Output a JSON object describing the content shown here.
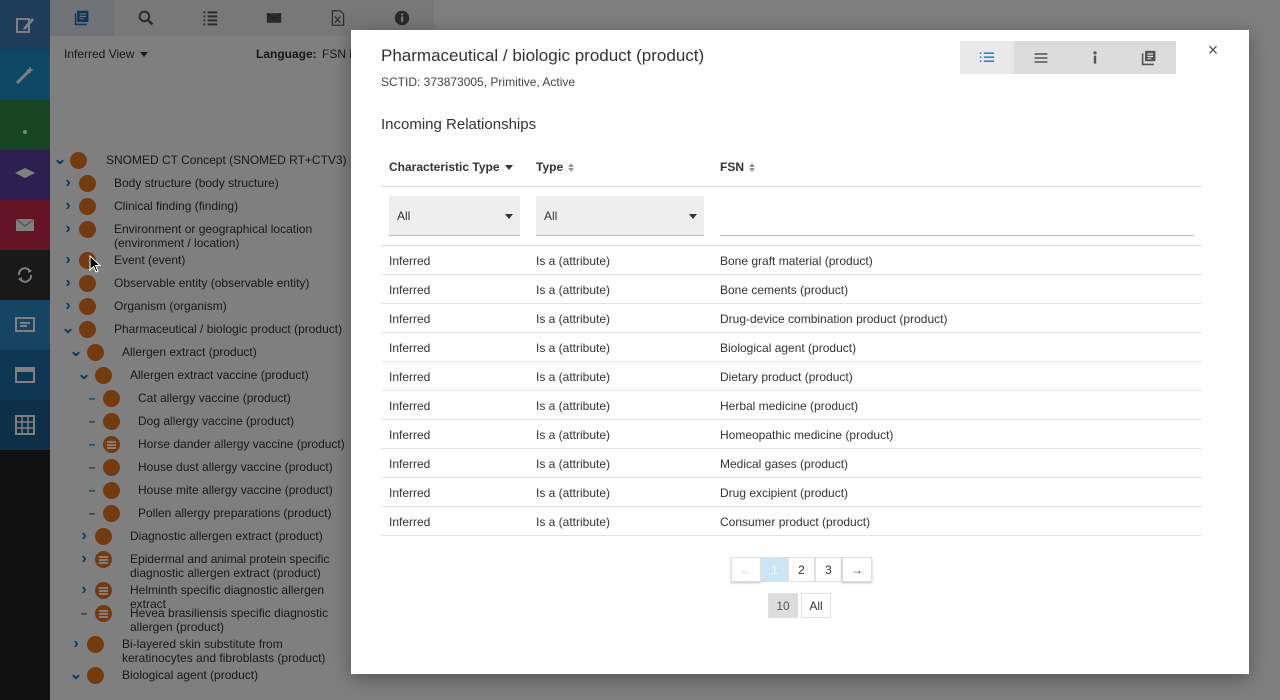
{
  "rail": {
    "items": [
      {
        "icon": "edit-icon",
        "color": "#3a7bb5"
      },
      {
        "icon": "wand-icon",
        "color": "#1b8fc7"
      },
      {
        "icon": "bell-icon",
        "color": "#2e8b45"
      },
      {
        "icon": "graduation-icon",
        "color": "#5b3fa1"
      },
      {
        "icon": "mail-icon",
        "color": "#c9284a"
      },
      {
        "icon": "sync-icon",
        "color": "#333333"
      },
      {
        "icon": "feedback-icon",
        "color": "#2d8ac9"
      },
      {
        "icon": "browser-icon",
        "color": "#1f6fa6"
      },
      {
        "icon": "grid-icon",
        "color": "#1a5f8f"
      }
    ]
  },
  "panel": {
    "tabs": [
      "taxonomy-icon",
      "search-icon",
      "list-icon",
      "mail-icon",
      "excel-icon",
      "info-icon"
    ],
    "view_label": "Inferred View",
    "language_label": "Language:",
    "language_value": "FSN i",
    "tree": [
      {
        "label": "SNOMED CT Concept (SNOMED RT+CTV3)",
        "toggle": "open",
        "depth": 0,
        "dot": "plain"
      },
      {
        "label": "Body structure (body structure)",
        "toggle": "closed",
        "depth": 1,
        "dot": "plain"
      },
      {
        "label": "Clinical finding (finding)",
        "toggle": "closed",
        "depth": 1,
        "dot": "plain"
      },
      {
        "label": "Environment or geographical location (environment / location)",
        "toggle": "closed",
        "depth": 1,
        "dot": "plain"
      },
      {
        "label": "Event (event)",
        "toggle": "closed",
        "depth": 1,
        "dot": "plain"
      },
      {
        "label": "Observable entity (observable entity)",
        "toggle": "closed",
        "depth": 1,
        "dot": "plain"
      },
      {
        "label": "Organism (organism)",
        "toggle": "closed",
        "depth": 1,
        "dot": "plain"
      },
      {
        "label": "Pharmaceutical / biologic product (product)",
        "toggle": "open",
        "depth": 1,
        "dot": "plain"
      },
      {
        "label": "Allergen extract (product)",
        "toggle": "open",
        "depth": 2,
        "dot": "plain"
      },
      {
        "label": "Allergen extract vaccine (product)",
        "toggle": "open",
        "depth": 3,
        "dot": "plain"
      },
      {
        "label": "Cat allergy vaccine (product)",
        "toggle": "leaf",
        "depth": 4,
        "dot": "plain"
      },
      {
        "label": "Dog allergy vaccine (product)",
        "toggle": "leaf",
        "depth": 4,
        "dot": "plain"
      },
      {
        "label": "Horse dander allergy vaccine (product)",
        "toggle": "leaf",
        "depth": 4,
        "dot": "lines"
      },
      {
        "label": "House dust allergy vaccine (product)",
        "toggle": "leaf",
        "depth": 4,
        "dot": "plain"
      },
      {
        "label": "House mite allergy vaccine (product)",
        "toggle": "leaf",
        "depth": 4,
        "dot": "plain"
      },
      {
        "label": "Pollen allergy preparations (product)",
        "toggle": "leaf",
        "depth": 4,
        "dot": "plain"
      },
      {
        "label": "Diagnostic allergen extract (product)",
        "toggle": "closed",
        "depth": 3,
        "dot": "plain"
      },
      {
        "label": "Epidermal and animal protein specific diagnostic allergen extract (product)",
        "toggle": "closed",
        "depth": 3,
        "dot": "lines"
      },
      {
        "label": "Helminth specific diagnostic allergen extract",
        "toggle": "closed",
        "depth": 3,
        "dot": "lines"
      },
      {
        "label": "Hevea brasiliensis specific diagnostic allergen (product)",
        "toggle": "leaf",
        "depth": 3,
        "dot": "lines"
      },
      {
        "label": "Bi-layered skin substitute from keratinocytes and fibroblasts (product)",
        "toggle": "closed",
        "depth": 2,
        "dot": "plain"
      },
      {
        "label": "Biological agent (product)",
        "toggle": "open",
        "depth": 2,
        "dot": "plain"
      }
    ]
  },
  "modal": {
    "title": "Pharmaceutical / biologic product (product)",
    "subtitle": "SCTID: 373873005, Primitive, Active",
    "view_icons": [
      "list-view-icon",
      "lines-view-icon",
      "info-view-icon",
      "stack-view-icon"
    ],
    "close": "×",
    "section_title": "Incoming Relationships",
    "columns": [
      "Characteristic Type",
      "Type",
      "FSN"
    ],
    "filters": {
      "char_type": "All",
      "type": "All",
      "fsn": ""
    },
    "rows": [
      [
        "Inferred",
        "Is a (attribute)",
        "Bone graft material (product)"
      ],
      [
        "Inferred",
        "Is a (attribute)",
        "Bone cements (product)"
      ],
      [
        "Inferred",
        "Is a (attribute)",
        "Drug-device combination product (product)"
      ],
      [
        "Inferred",
        "Is a (attribute)",
        "Biological agent (product)"
      ],
      [
        "Inferred",
        "Is a (attribute)",
        "Dietary product (product)"
      ],
      [
        "Inferred",
        "Is a (attribute)",
        "Herbal medicine (product)"
      ],
      [
        "Inferred",
        "Is a (attribute)",
        "Homeopathic medicine (product)"
      ],
      [
        "Inferred",
        "Is a (attribute)",
        "Medical gases (product)"
      ],
      [
        "Inferred",
        "Is a (attribute)",
        "Drug excipient (product)"
      ],
      [
        "Inferred",
        "Is a (attribute)",
        "Consumer product (product)"
      ]
    ],
    "pagination": {
      "prev": "←",
      "pages": [
        "1",
        "2",
        "3"
      ],
      "current": "1",
      "next": "→"
    },
    "page_sizes": [
      "10",
      "All"
    ],
    "page_size_current": "10"
  }
}
